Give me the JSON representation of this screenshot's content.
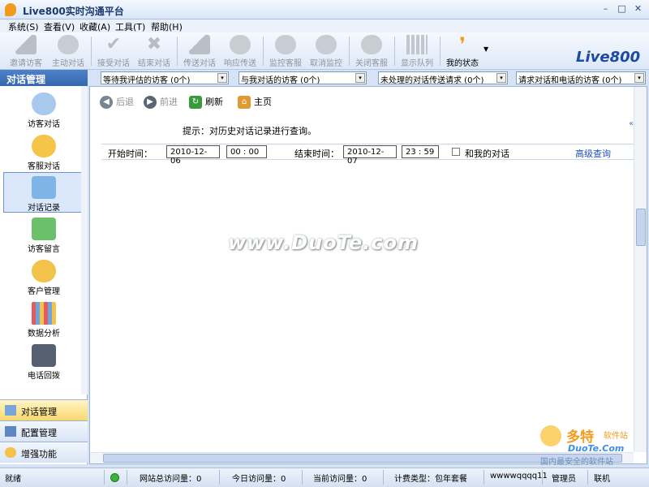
{
  "window": {
    "title": "Live800实时沟通平台",
    "minimize": "–",
    "maximize": "□",
    "close": "✕"
  },
  "menu": [
    "系统(S)",
    "查看(V)",
    "收藏(A)",
    "工具(T)",
    "帮助(H)"
  ],
  "toolbar": {
    "buttons": [
      {
        "label": "邀请访客",
        "icon": "invite-icon"
      },
      {
        "label": "主动对话",
        "icon": "chat-bubble-icon"
      },
      {
        "label": "接受对话",
        "icon": "check-icon"
      },
      {
        "label": "结束对话",
        "icon": "x-icon"
      },
      {
        "label": "传送对话",
        "icon": "transfer-icon"
      },
      {
        "label": "响应传送",
        "icon": "signal-icon"
      },
      {
        "label": "监控客服",
        "icon": "monitor-icon"
      },
      {
        "label": "取消监控",
        "icon": "cancel-monitor-icon"
      },
      {
        "label": "关闭客服",
        "icon": "close-agent-icon"
      },
      {
        "label": "显示队列",
        "icon": "queue-icon"
      },
      {
        "label": "我的状态",
        "icon": "status-icon"
      }
    ],
    "brand": "Live800"
  },
  "section_title": "对话管理",
  "filters": [
    "等待我评估的访客 (0个)",
    "与我对话的访客 (0个)",
    "未处理的对话传送请求 (0个)",
    "请求对话和电话的访客 (0个)"
  ],
  "sidebar": {
    "items": [
      {
        "label": "访客对话",
        "icon": "visitor-chat-icon"
      },
      {
        "label": "客服对话",
        "icon": "agent-chat-icon"
      },
      {
        "label": "对话记录",
        "icon": "chat-record-icon"
      },
      {
        "label": "访客留言",
        "icon": "visitor-message-icon"
      },
      {
        "label": "客户管理",
        "icon": "customer-icon"
      },
      {
        "label": "数据分析",
        "icon": "chart-icon"
      },
      {
        "label": "电话回拨",
        "icon": "phone-icon"
      }
    ],
    "nav": [
      {
        "label": "对话管理",
        "icon": "chat-manage-icon"
      },
      {
        "label": "配置管理",
        "icon": "config-icon"
      },
      {
        "label": "增强功能",
        "icon": "enhance-icon"
      }
    ]
  },
  "content": {
    "back": "后退",
    "forward": "前进",
    "refresh": "刷新",
    "home": "主页",
    "tip": "提示：对历史对话记录进行查询。",
    "start_label": "开始时间：",
    "start_date": "2010-12-06",
    "start_time": "00 : 00",
    "end_label": "结束时间：",
    "end_date": "2010-12-07",
    "end_time": "23 : 59",
    "mine_label": "和我的对话",
    "advanced": "高级查询",
    "watermark": "www.DuoTe.com"
  },
  "logo_wm": {
    "t1": "多特",
    "t2": "软件站",
    "t3": "DuoTe.Com",
    "t4": "国内最安全的软件站"
  },
  "status": {
    "ready": "就绪",
    "site_total": "网站总访问量：0",
    "today": "今日访问量：0",
    "current": "当前访问量：0",
    "billing": "计费类型：包年套餐",
    "user": "wwwwqqqq11",
    "role": "管理员",
    "online": "联机"
  }
}
